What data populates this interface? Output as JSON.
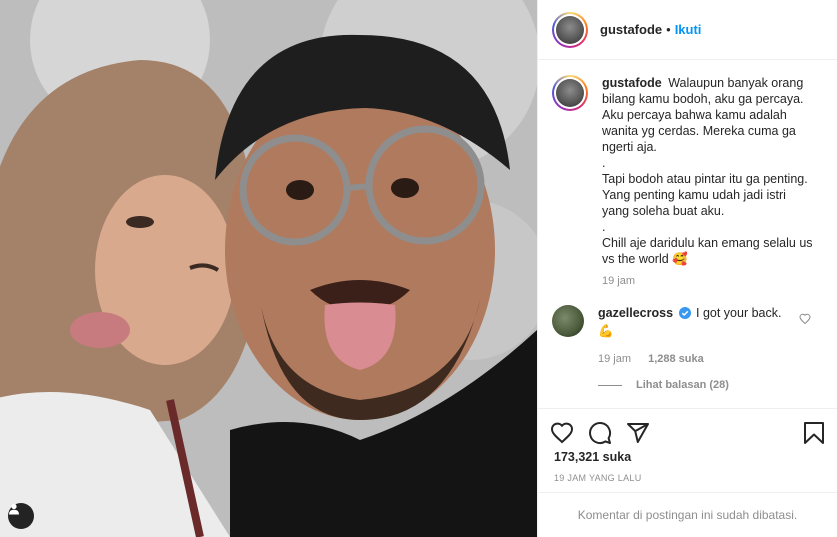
{
  "post": {
    "username": "gustafode",
    "separator": "•",
    "follow_label": "Ikuti"
  },
  "caption": {
    "username": "gustafode",
    "text": "Walaupun banyak orang bilang kamu bodoh, aku ga percaya. Aku percaya bahwa kamu adalah wanita yg cerdas. Mereka cuma ga ngerti aja.\n.\nTapi bodoh atau pintar itu ga penting. Yang penting kamu udah jadi istri yang soleha buat aku.\n.\nChill aje daridulu kan emang selalu us vs the world 🥰",
    "time": "19 jam"
  },
  "comments": [
    {
      "username": "gazellecross",
      "text": "I got your back.",
      "emoji": "💪",
      "time": "19 jam",
      "likes": "1,288 suka",
      "view_replies": "Lihat balasan (28)"
    }
  ],
  "stats": {
    "likes": "173,321 suka",
    "posted": "19 JAM YANG LALU"
  },
  "footer": {
    "comments_limited": "Komentar di postingan ini sudah dibatasi."
  },
  "icons": [
    "heart-icon",
    "comment-icon",
    "share-icon",
    "bookmark-icon",
    "verified-icon",
    "tag-user-icon"
  ],
  "colors": {
    "link": "#0095f6",
    "muted": "#8e8e8e",
    "text": "#262626",
    "verified": "#3897f0"
  }
}
